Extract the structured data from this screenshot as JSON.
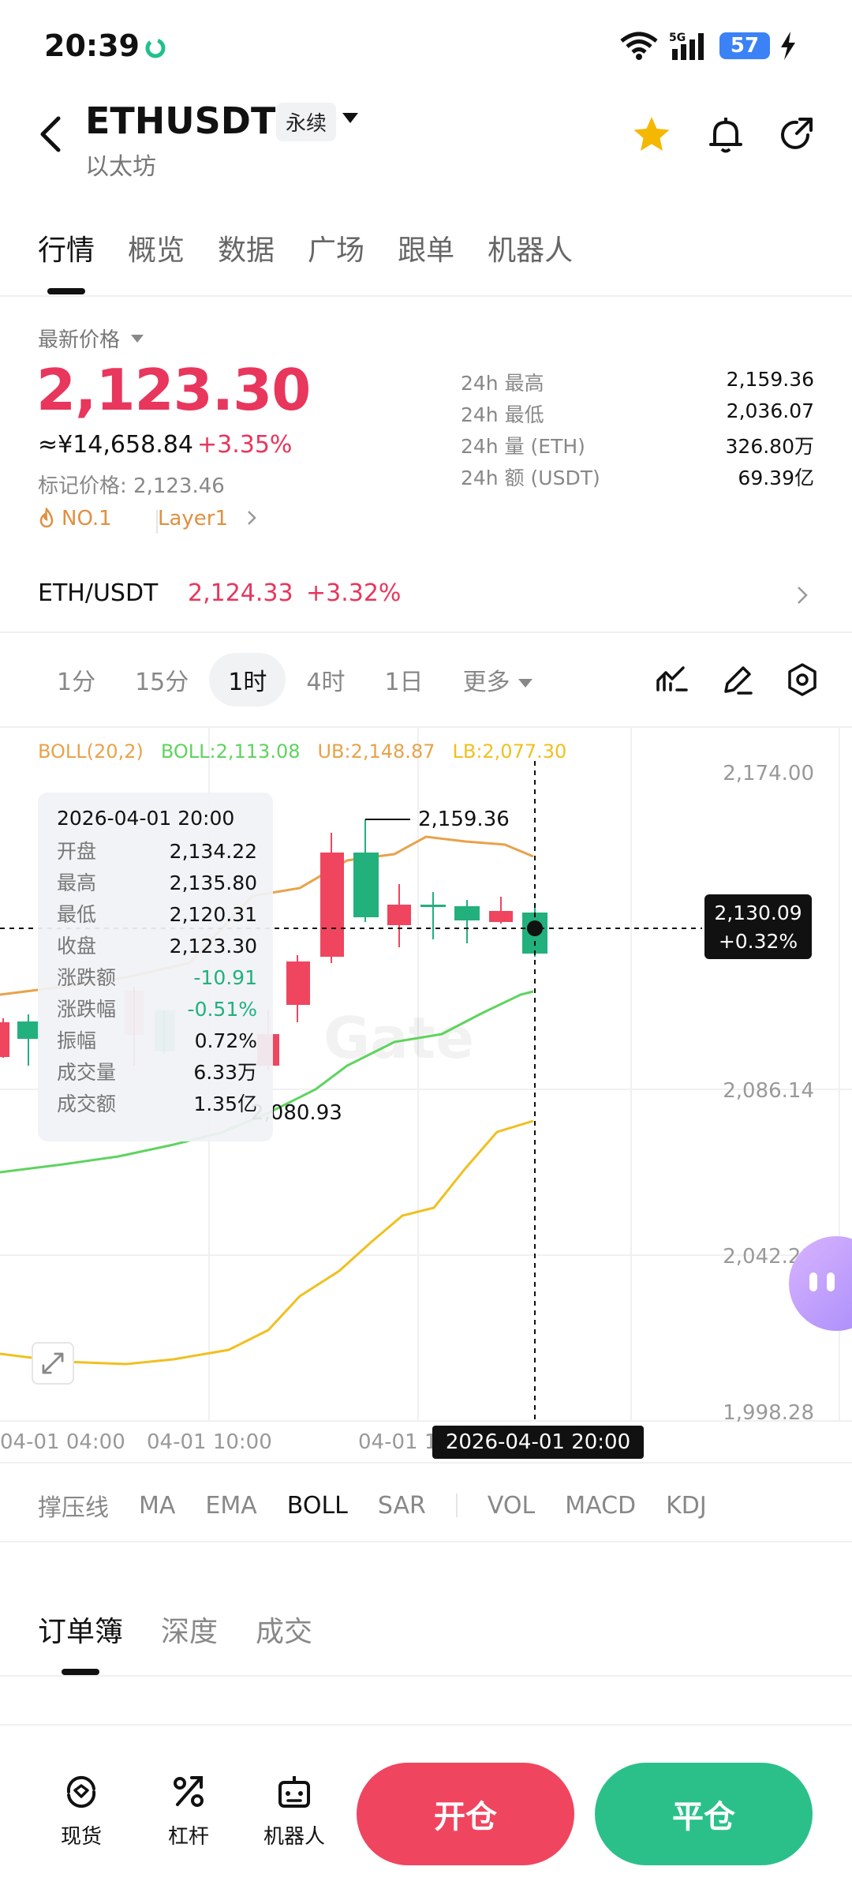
{
  "status_bar": {
    "time": "20:39",
    "network": "5G",
    "battery": "57"
  },
  "header": {
    "symbol": "ETHUSDT",
    "contract_type": "永续",
    "subtitle": "以太坊"
  },
  "tabs": [
    "行情",
    "概览",
    "数据",
    "广场",
    "跟单",
    "机器人"
  ],
  "price": {
    "label": "最新价格",
    "last": "2,123.30",
    "cny": "≈¥14,658.84",
    "change_pct": "+3.35%",
    "mark_price": "标记价格: 2,123.46",
    "tag_rank": "NO.1",
    "tag_category": "Layer1"
  },
  "stats_24h": [
    {
      "label": "24h  最高",
      "value": "2,159.36"
    },
    {
      "label": "24h  最低",
      "value": "2,036.07"
    },
    {
      "label": "24h  量 (ETH)",
      "value": "326.80万"
    },
    {
      "label": "24h  额 (USDT)",
      "value": "69.39亿"
    }
  ],
  "spot": {
    "pair": "ETH/USDT",
    "price": "2,124.33",
    "change_pct": "+3.32%"
  },
  "intervals": [
    "1分",
    "15分",
    "1时",
    "4时",
    "1日",
    "更多"
  ],
  "active_interval": "1时",
  "boll_legend": {
    "name": "BOLL(20,2)",
    "boll": "BOLL:2,113.08",
    "ub": "UB:2,148.87",
    "lb": "LB:2,077.30"
  },
  "chart": {
    "y_ticks": [
      "2,174.00",
      "2,086.14",
      "2,042.21",
      "1,998.28"
    ],
    "x_ticks": [
      "04-01 04:00",
      "04-01 10:00",
      "04-01 1"
    ],
    "high_marker": "2,159.36",
    "low_marker": "2,080.93",
    "crosshair_price": "2,130.09",
    "crosshair_pct": "+0.32%",
    "crosshair_time": "2026-04-01 20:00",
    "watermark": "Gate"
  },
  "tooltip": {
    "date": "2026-04-01 20:00",
    "rows": [
      {
        "label": "开盘",
        "value": "2,134.22"
      },
      {
        "label": "最高",
        "value": "2,135.80"
      },
      {
        "label": "最低",
        "value": "2,120.31"
      },
      {
        "label": "收盘",
        "value": "2,123.30"
      },
      {
        "label": "涨跌额",
        "value": "-10.91"
      },
      {
        "label": "涨跌幅",
        "value": "-0.51%"
      },
      {
        "label": "振幅",
        "value": "0.72%"
      },
      {
        "label": "成交量",
        "value": "6.33万"
      },
      {
        "label": "成交额",
        "value": "1.35亿"
      }
    ]
  },
  "indicators": [
    "撑压线",
    "MA",
    "EMA",
    "BOLL",
    "SAR",
    "VOL",
    "MACD",
    "KDJ"
  ],
  "active_indicator": "BOLL",
  "orderbook_tabs": [
    "订单簿",
    "深度",
    "成交"
  ],
  "bottom_nav": [
    "现货",
    "杠杆",
    "机器人"
  ],
  "actions": {
    "open": "开仓",
    "close": "平仓"
  },
  "colors": {
    "up": "#e8365d",
    "down": "#22b07d",
    "accent_orange": "#e09040"
  }
}
